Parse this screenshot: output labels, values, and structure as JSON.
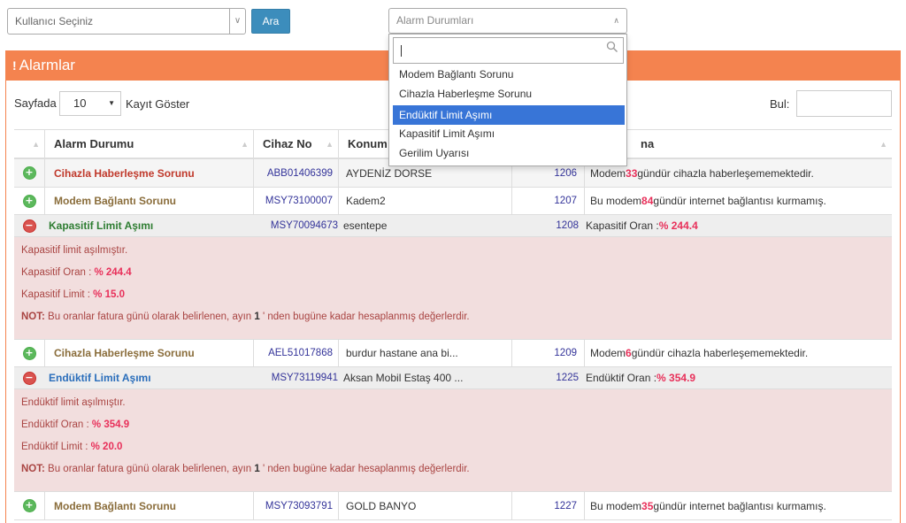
{
  "top": {
    "user_select_placeholder": "Kullanıcı Seçiniz",
    "search_button": "Ara",
    "alarm_filter_placeholder": "Alarm Durumları"
  },
  "panel": {
    "title": "Alarmlar"
  },
  "controls": {
    "page_label": "Sayfada",
    "page_length": "10",
    "show_records": "Kayıt Göster",
    "search_label": "Bul:"
  },
  "table": {
    "columns": [
      "Alarm Durumu",
      "Cihaz No",
      "Konum",
      "",
      "Açıklama"
    ],
    "col4_visible_tail": "na",
    "rows": [
      {
        "status": "Cihazla Haberleşme Sorunu",
        "device": "ABB01406399",
        "location": "AYDENİZ DORSE",
        "id": "1206",
        "desc_pre": "Modem ",
        "desc_num": "33",
        "desc_post": " gündür cihazla haberleşememektedir."
      },
      {
        "status": "Modem Bağlantı Sorunu",
        "device": "MSY73100007",
        "location": "Kadem2",
        "id": "1207",
        "desc_pre": "Bu modem ",
        "desc_num": "84",
        "desc_post": " gündür internet bağlantısı kurmamış."
      },
      {
        "status": "Kapasitif Limit Aşımı",
        "device": "MSY70094673",
        "location": "esentepe",
        "id": "1208",
        "desc_pre": "Kapasitif Oran : ",
        "desc_num": "% 244.4",
        "desc_post": ""
      },
      {
        "status": "Cihazla Haberleşme Sorunu",
        "device": "AEL51017868",
        "location": "burdur hastane ana bi...",
        "id": "1209",
        "desc_pre": "Modem ",
        "desc_num": "6",
        "desc_post": " gündür cihazla haberleşememektedir."
      },
      {
        "status": "Endüktif Limit Aşımı",
        "device": "MSY73119941",
        "location": "Aksan Mobil Estaş 400 ...",
        "id": "1225",
        "desc_pre": "Endüktif Oran : ",
        "desc_num": "% 354.9",
        "desc_post": ""
      },
      {
        "status": "Modem Bağlantı Sorunu",
        "device": "MSY73093791",
        "location": "GOLD BANYO",
        "id": "1227",
        "desc_pre": "Bu modem ",
        "desc_num": "35",
        "desc_post": " gündür internet bağlantısı kurmamış."
      }
    ],
    "details": [
      {
        "line1": "Kapasitif limit aşılmıştır.",
        "ratio_label": "Kapasitif Oran : ",
        "ratio_value": "% 244.4",
        "limit_label": "Kapasitif Limit : ",
        "limit_value": "% 15.0"
      },
      {
        "line1": "Endüktif limit aşılmıştır.",
        "ratio_label": "Endüktif Oran : ",
        "ratio_value": "% 354.9",
        "limit_label": "Endüktif Limit : ",
        "limit_value": "% 20.0"
      }
    ],
    "note_label": "NOT:",
    "note_pre": " Bu oranlar fatura günü olarak belirlenen, ayın ",
    "note_num": "1",
    "note_post": " ' nden bugüne kadar hesaplanmış değerlerdir."
  },
  "dropdown": {
    "options": [
      "Modem Bağlantı Sorunu",
      "Cihazla Haberleşme Sorunu",
      "Endüktif Limit Aşımı",
      "Kapasitif Limit Aşımı",
      "Gerilim Uyarısı"
    ],
    "selected_index": 2
  },
  "colors": {
    "panel_header": "#f4834f",
    "button": "#3c8dbc",
    "dropdown_highlight": "#3875d7",
    "detail_bg": "#f2dede",
    "highlight_value": "#e8305a"
  }
}
